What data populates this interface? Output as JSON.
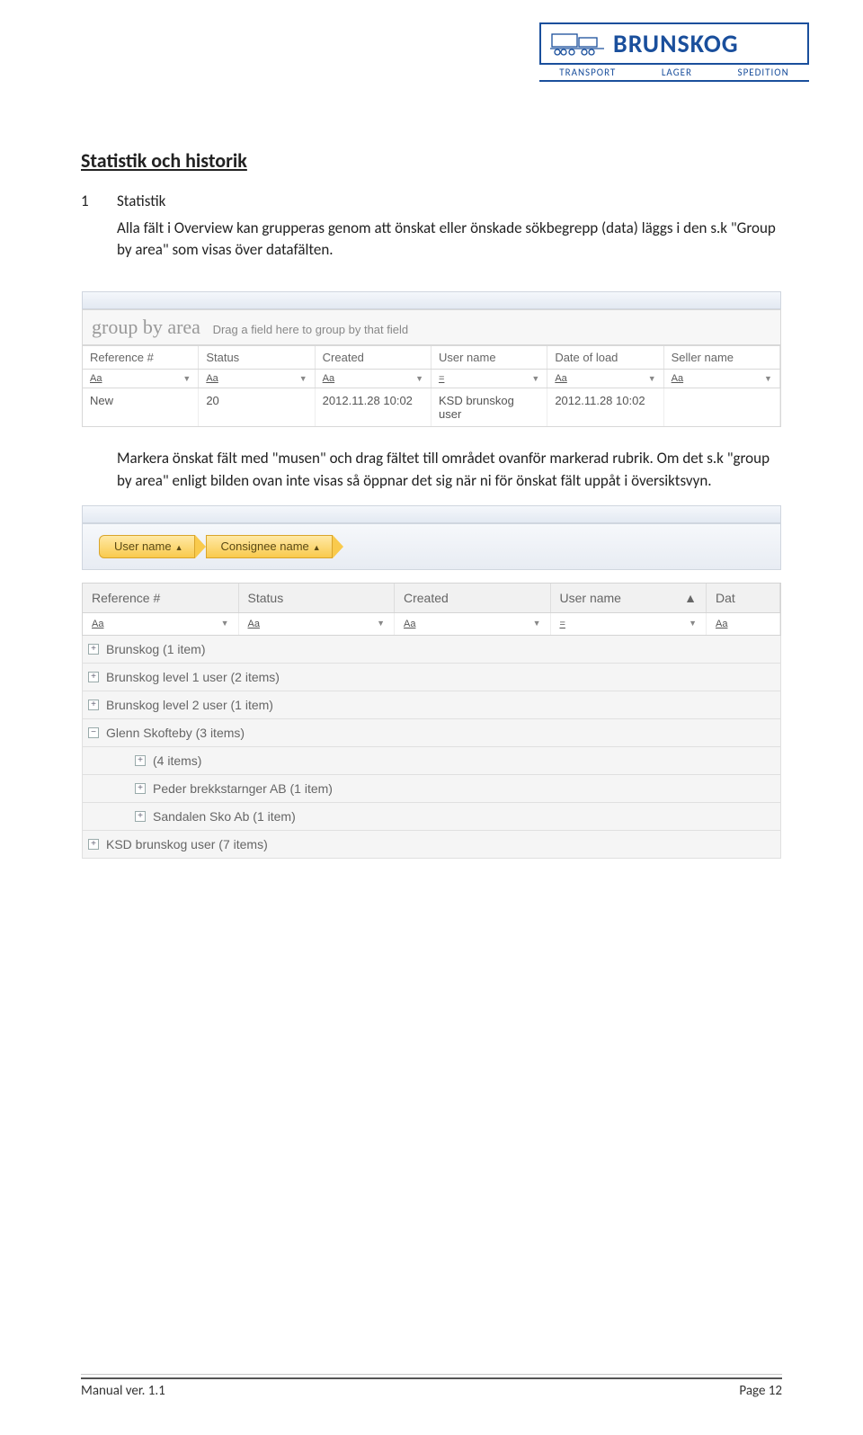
{
  "logo": {
    "name": "BRUNSKOG",
    "taglines": [
      "TRANSPORT",
      "LAGER",
      "SPEDITION"
    ]
  },
  "section_title": "Statistik och historik",
  "item_number": "1",
  "item_title": "Statistik",
  "para1": "Alla fält i Overview kan grupperas genom att önskat eller önskade sökbegrepp (data) läggs i den s.k \"Group by area\" som visas över datafälten.",
  "para2": "Markera önskat fält med \"musen\" och drag fältet till området ovanför markerad rubrik. Om det s.k \"group by area\" enligt bilden ovan inte visas så öppnar det sig när ni för önskat fält uppåt i översiktsvyn.",
  "ss1": {
    "gba_title": "group by area",
    "gba_hint": "Drag a field here to group by that field",
    "headers": [
      "Reference #",
      "Status",
      "Created",
      "User name",
      "Date of load",
      "Seller name"
    ],
    "filter_icons": [
      "Aa",
      "Aa",
      "Aa",
      "=",
      "Aa",
      "Aa"
    ],
    "row": [
      "New",
      "20",
      "2012.11.28 10:02",
      "KSD brunskog user",
      "2012.11.28 10:02",
      ""
    ]
  },
  "ss2": {
    "group_tags": [
      "User name",
      "Consignee name"
    ],
    "headers": [
      "Reference #",
      "Status",
      "Created",
      "User name",
      "Dat"
    ],
    "filter_icons": [
      "Aa",
      "Aa",
      "Aa",
      "=",
      "Aa"
    ],
    "rows": [
      {
        "exp": "+",
        "indent": 0,
        "label": "Brunskog (1 item)"
      },
      {
        "exp": "+",
        "indent": 0,
        "label": "Brunskog level 1 user (2 items)"
      },
      {
        "exp": "+",
        "indent": 0,
        "label": "Brunskog level 2 user (1 item)"
      },
      {
        "exp": "−",
        "indent": 0,
        "label": "Glenn Skofteby (3 items)"
      },
      {
        "exp": "+",
        "indent": 1,
        "label": "(4 items)"
      },
      {
        "exp": "+",
        "indent": 1,
        "label": "Peder brekkstarnger AB (1 item)"
      },
      {
        "exp": "+",
        "indent": 1,
        "label": "Sandalen Sko Ab (1 item)"
      },
      {
        "exp": "+",
        "indent": 0,
        "label": "KSD brunskog user (7 items)"
      }
    ]
  },
  "footer": {
    "left": "Manual ver. 1.1",
    "right": "Page 12"
  }
}
